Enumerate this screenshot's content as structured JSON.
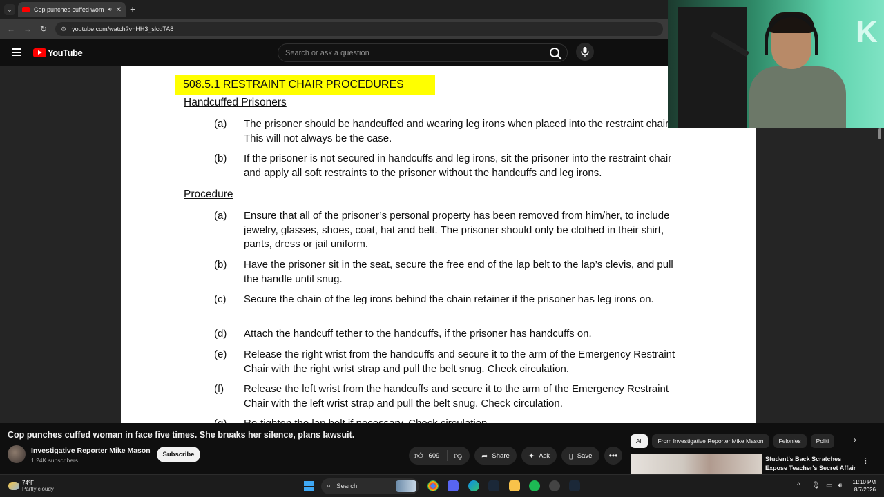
{
  "browser": {
    "tab_title": "Cop punches cuffed woman",
    "url": "youtube.com/watch?v=HH3_slcqTA8"
  },
  "youtube": {
    "logo_text": "YouTube",
    "search_placeholder": "Search or ask a question"
  },
  "document": {
    "heading": "508.5.1   RESTRAINT CHAIR PROCEDURES",
    "section1_title": "Handcuffed Prisoners",
    "section1_items": [
      {
        "letter": "(a)",
        "text": "The prisoner should be handcuffed and wearing leg irons when placed into the restraint chair. This will not always be the case."
      },
      {
        "letter": "(b)",
        "text": "If the prisoner is not secured in handcuffs and leg irons, sit the prisoner into the restraint chair and apply all soft restraints to the prisoner without the handcuffs and leg irons."
      }
    ],
    "section2_title": "Procedure",
    "section2_items": [
      {
        "letter": "(a)",
        "text": "Ensure that all of the prisoner’s personal property has been removed from him/her, to include jewelry, glasses, shoes, coat, hat and belt.  The prisoner should only be clothed in their shirt, pants, dress or jail uniform."
      },
      {
        "letter": "(b)",
        "text": "Have the prisoner sit in the seat, secure the free end of the lap belt to the lap’s clevis, and pull the handle until snug."
      },
      {
        "letter": "(c)",
        "text": "Secure the chain of the leg irons behind the chain retainer if the prisoner has leg irons on."
      },
      {
        "letter": "(d)",
        "text": "Attach the handcuff tether to the handcuffs, if the prisoner has handcuffs on."
      },
      {
        "letter": "(e)",
        "text": "Release the right wrist from the handcuffs and secure it to the arm of the Emergency Restraint Chair with the right wrist strap and pull the belt snug.  Check circulation."
      },
      {
        "letter": "(f)",
        "text": "Release the left wrist from the handcuffs and secure it to the arm of the Emergency Restraint Chair with the left wrist strap and pull the belt snug.  Check circulation."
      },
      {
        "letter": "(g)",
        "text": "Re-tighten the lap belt if necessary. Check circulation."
      }
    ]
  },
  "webcam": {
    "overlay_letter": "K"
  },
  "video": {
    "title": "Cop punches cuffed woman in face five times. She breaks her silence, plans lawsuit.",
    "channel_name": "Investigative Reporter Mike Mason",
    "subscribers": "1.24K subscribers",
    "subscribe_label": "Subscribe",
    "like_count": "609",
    "share_label": "Share",
    "ask_label": "Ask",
    "save_label": "Save"
  },
  "recommendations": {
    "chips": [
      "All",
      "From Investigative Reporter Mike Mason",
      "Felonies",
      "Politi"
    ],
    "first_title": "Student's Back Scratches Expose Teacher's Secret Affair"
  },
  "taskbar": {
    "temperature": "74°F",
    "weather": "Partly cloudy",
    "search_label": "Search",
    "time": "11:10 PM",
    "date": "8/7/2026"
  },
  "colors": {
    "youtube_red": "#ff0000",
    "doc_highlight": "#ffff00",
    "windows_blue": "#3fa8f5"
  }
}
